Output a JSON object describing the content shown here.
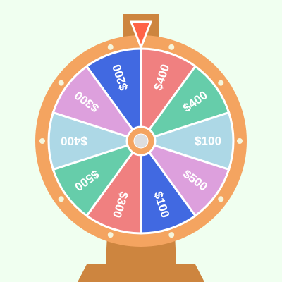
{
  "game": {
    "segments": [
      {
        "label": "$400",
        "color": "#F08080"
      },
      {
        "label": "$400",
        "color": "#66CDAA"
      },
      {
        "label": "$100",
        "color": "#ADD8E6"
      },
      {
        "label": "$500",
        "color": "#DDA0DD"
      },
      {
        "label": "$100",
        "color": "#4169E1"
      },
      {
        "label": "$300",
        "color": "#F08080"
      },
      {
        "label": "$500",
        "color": "#66CDAA"
      },
      {
        "label": "$400",
        "color": "#ADD8E6"
      },
      {
        "label": "$300",
        "color": "#DDA0DD"
      },
      {
        "label": "$200",
        "color": "#4169E1"
      }
    ],
    "colors": {
      "background": "#F0FFF0",
      "rim": "#F4A460",
      "stand": "#CD853F",
      "pointer": "#FF6347",
      "rim_lights": "#F5F5DC",
      "hub_center": "#DDDDDD"
    }
  }
}
